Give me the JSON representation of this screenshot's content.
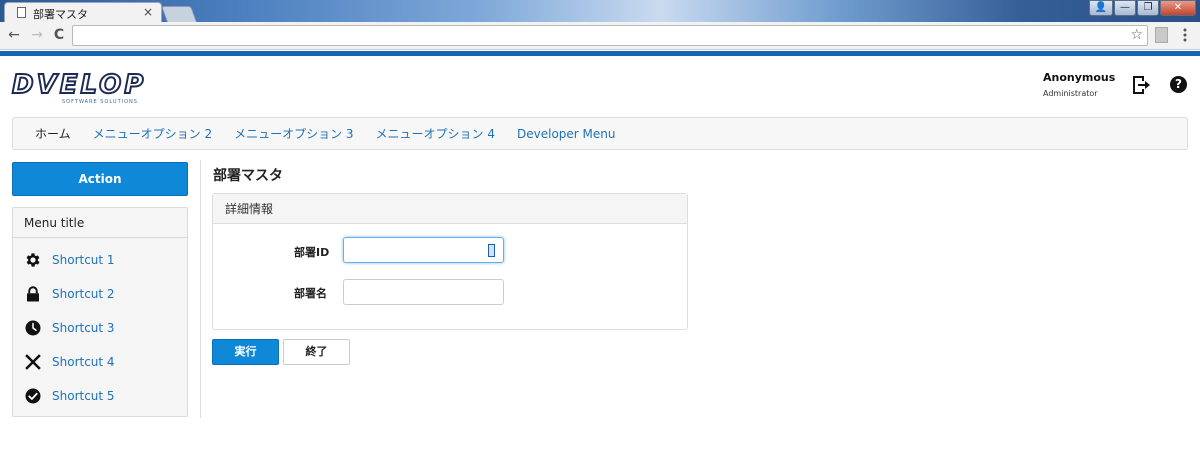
{
  "browser": {
    "tab_title": "部署マスタ",
    "tab_close": "×",
    "back": "←",
    "forward": "→",
    "reload": "C",
    "url": "",
    "star": "☆",
    "window": {
      "user": "👤",
      "minimize": "—",
      "maximize": "❐",
      "close": "✕"
    }
  },
  "header": {
    "logo_main": "DVELOP",
    "logo_sub": "SOFTWARE SOLUTIONS",
    "user_name": "Anonymous",
    "user_role": "Administrator",
    "help": "?"
  },
  "nav": {
    "items": [
      {
        "label": "ホーム",
        "active": true
      },
      {
        "label": "メニューオプション 2"
      },
      {
        "label": "メニューオプション 3"
      },
      {
        "label": "メニューオプション 4"
      },
      {
        "label": "Developer Menu"
      }
    ]
  },
  "sidebar": {
    "action_label": "Action",
    "menu_title": "Menu title",
    "shortcuts": [
      {
        "label": "Shortcut 1",
        "icon": "gear-icon"
      },
      {
        "label": "Shortcut 2",
        "icon": "lock-icon"
      },
      {
        "label": "Shortcut 3",
        "icon": "clock-icon"
      },
      {
        "label": "Shortcut 4",
        "icon": "close-icon"
      },
      {
        "label": "Shortcut 5",
        "icon": "check-circle-icon"
      }
    ]
  },
  "content": {
    "page_title": "部署マスタ",
    "panel_title": "詳細情報",
    "fields": {
      "dept_id": {
        "label": "部署ID",
        "value": ""
      },
      "dept_name": {
        "label": "部署名",
        "value": ""
      }
    },
    "exec_label": "実行",
    "close_label": "終了"
  },
  "colors": {
    "accent": "#0f88d8",
    "brand_bar": "#1367b3",
    "link": "#1f72b8"
  }
}
